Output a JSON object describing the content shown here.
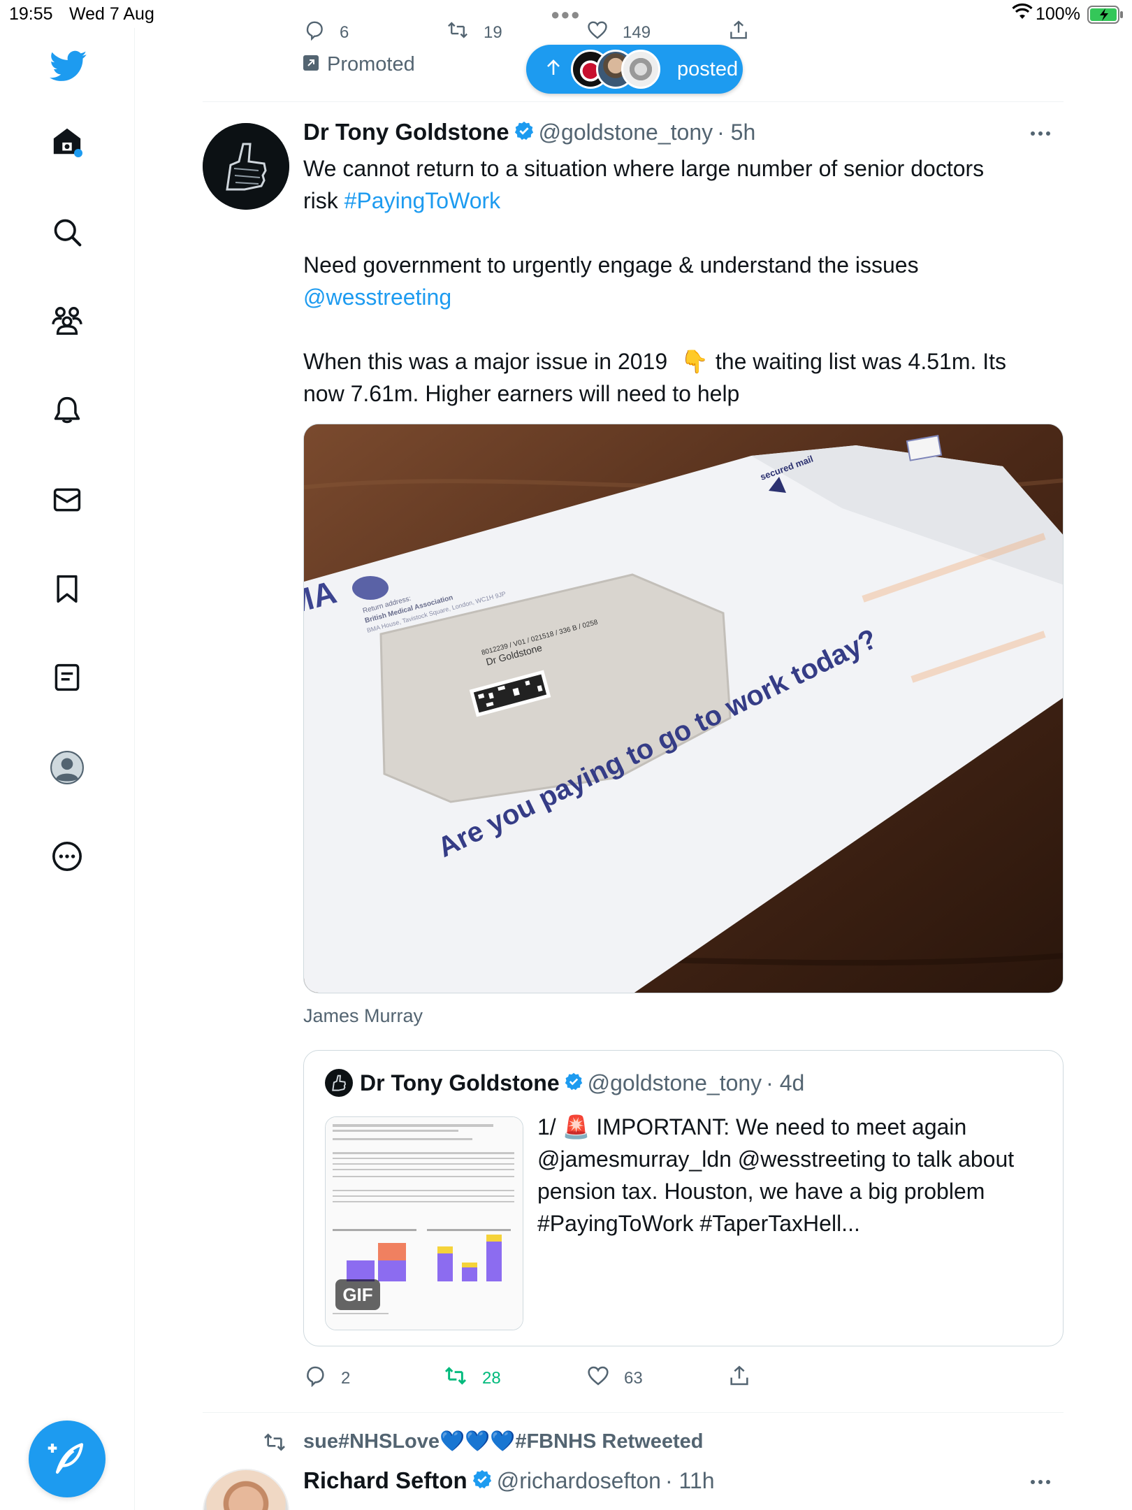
{
  "status_bar": {
    "time": "19:55",
    "date": "Wed 7 Aug",
    "battery": "100%"
  },
  "sidebar": {
    "items": [
      {
        "name": "home",
        "icon": "home-icon"
      },
      {
        "name": "explore",
        "icon": "search-icon"
      },
      {
        "name": "communities",
        "icon": "communities-icon"
      },
      {
        "name": "notifications",
        "icon": "bell-icon"
      },
      {
        "name": "messages",
        "icon": "mail-icon"
      },
      {
        "name": "bookmarks",
        "icon": "bookmark-icon"
      },
      {
        "name": "lists",
        "icon": "list-icon"
      },
      {
        "name": "profile",
        "icon": "avatar-icon"
      },
      {
        "name": "more",
        "icon": "more-icon"
      }
    ],
    "compose_icon": "compose-icon"
  },
  "prev_tweet": {
    "replies": "6",
    "retweets": "19",
    "likes": "149",
    "promoted_label": "Promoted"
  },
  "new_posts_pill": {
    "label": "posted"
  },
  "tweet": {
    "author_name": "Dr Tony Goldstone",
    "author_handle": "@goldstone_tony",
    "time": "· 5h",
    "text_line1": "We cannot return to a situation where large number of senior doctors",
    "text_line2_prefix": "risk ",
    "hashtag1": "#PayingToWork",
    "text_para2": "Need government to urgently engage & understand the issues",
    "mention1": "@wesstreeting",
    "text_para3a": "When this was a major issue in 2019",
    "emoji_point": "👇",
    "text_para3b": "the waiting list was 4.51m. Its",
    "text_para3c": "now 7.61m. Higher earners will need to help",
    "image_tag": "James Murray",
    "envelope": {
      "brand": "BMA",
      "return_line1": "Return address:",
      "return_line2": "British Medical Association",
      "return_line3": "BMA House, Tavistock Square, London, WC1H 9JP",
      "ref": "8012239 / V01 / 021518 / 336 B / 0258",
      "addressee": "Dr Goldstone",
      "headline": "Are you paying to go to work today?",
      "mail_badge": "secured mail"
    },
    "quote": {
      "author_name": "Dr Tony Goldstone",
      "author_handle": "@goldstone_tony",
      "time": "· 4d",
      "prefix": "1/",
      "emoji": "🚨",
      "line1": "IMPORTANT: We need to meet again",
      "line2": "@jamesmurray_ldn @wesstreeting to talk about",
      "line3": "pension tax. Houston, we have a big problem",
      "line4": "#PayingToWork #TaperTaxHell...",
      "gif_label": "GIF"
    },
    "stats": {
      "replies": "2",
      "retweets": "28",
      "likes": "63"
    }
  },
  "next_tweet": {
    "retweeted_by": "sue#NHSLove💙💙💙#FBNHS Retweeted",
    "author_name": "Richard Sefton",
    "author_handle": "@richardosefton",
    "time": "· 11h"
  },
  "colors": {
    "accent": "#1d9bf0",
    "retweet_green": "#00ba7c",
    "muted": "#536471"
  }
}
